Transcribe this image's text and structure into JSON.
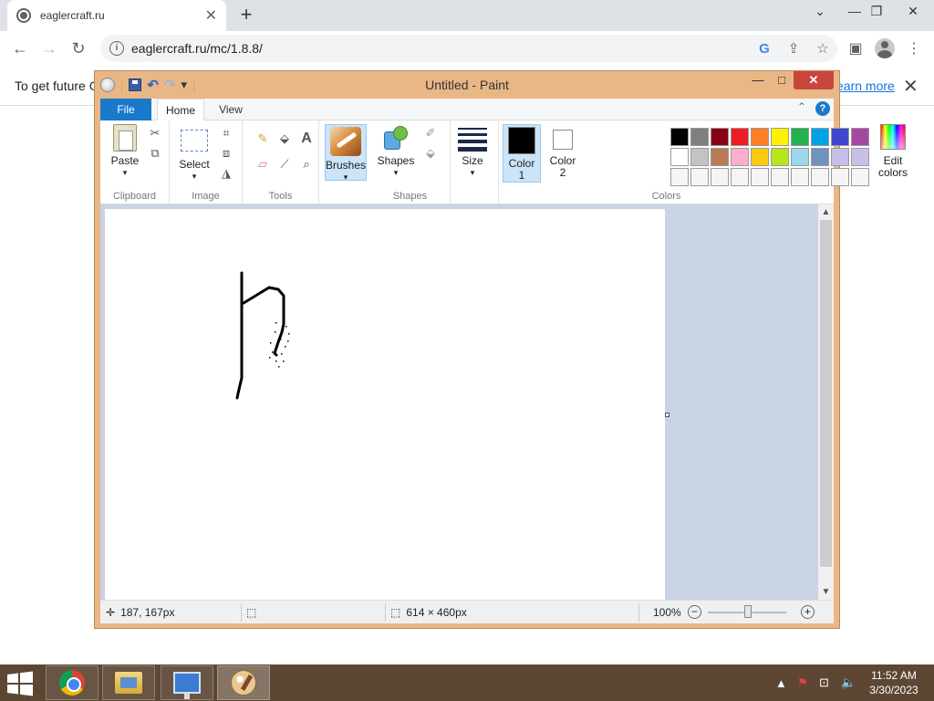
{
  "browser": {
    "tab": {
      "title": "eaglercraft.ru"
    },
    "address": {
      "url": "eaglercraft.ru/mc/1.8.8/"
    },
    "infobar": {
      "message": "To get future G",
      "link": "earn more"
    }
  },
  "paint": {
    "title": "Untitled - Paint",
    "tabs": {
      "file": "File",
      "home": "Home",
      "view": "View"
    },
    "groups": {
      "clipboard": {
        "label": "Clipboard",
        "paste": "Paste"
      },
      "image": {
        "label": "Image",
        "select": "Select"
      },
      "tools": {
        "label": "Tools"
      },
      "brushes": {
        "label": "Brushes"
      },
      "shapes": {
        "label": "Shapes",
        "button": "Shapes"
      },
      "size": {
        "label": "Size"
      },
      "colors": {
        "label": "Colors",
        "color1": "Color\n1",
        "color1_a": "Color",
        "color1_b": "1",
        "color2_a": "Color",
        "color2_b": "2",
        "edit_a": "Edit",
        "edit_b": "colors",
        "color1_value": "#000000",
        "color2_value": "#ffffff",
        "palette": [
          "#000000",
          "#7f7f7f",
          "#880015",
          "#ed1c24",
          "#ff7f27",
          "#fff200",
          "#22b14c",
          "#00a2e8",
          "#3f48cc",
          "#a349a4",
          "#ffffff",
          "#c3c3c3",
          "#b97a57",
          "#ffaec9",
          "#ffc90e",
          "#b5e61d",
          "#99d9ea",
          "#7092be",
          "#c8bfe7",
          "#c8bfe7",
          "#f5f5f5",
          "#f5f5f5",
          "#f5f5f5",
          "#f5f5f5",
          "#f5f5f5",
          "#f5f5f5",
          "#f5f5f5",
          "#f5f5f5",
          "#f5f5f5",
          "#f5f5f5"
        ]
      }
    },
    "status": {
      "cursor": "187, 167px",
      "canvas_size": "614 × 460px",
      "zoom": "100%"
    }
  },
  "taskbar": {
    "time": "11:52 AM",
    "date": "3/30/2023"
  }
}
